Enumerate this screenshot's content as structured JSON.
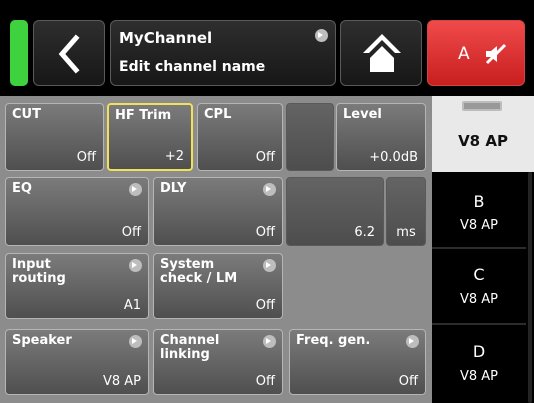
{
  "header": {
    "channel_name": "MyChannel",
    "edit_hint": "Edit channel name",
    "mute_label": "A"
  },
  "icons": {
    "status": "status-led-icon",
    "back": "chevron-left-icon",
    "home": "home-icon",
    "mute": "speaker-muted-icon",
    "submenu": "submenu-arrow-icon"
  },
  "colors": {
    "status_led": "#3fd23f",
    "mute_button": "#e0312f",
    "selected_outline": "#f0e15a"
  },
  "tiles": {
    "cut": {
      "label": "CUT",
      "value": "Off"
    },
    "hf_trim": {
      "label": "HF Trim",
      "value": "+2"
    },
    "cpl": {
      "label": "CPL",
      "value": "Off"
    },
    "level": {
      "label": "Level",
      "value": "+0.0dB"
    },
    "eq": {
      "label": "EQ",
      "value": "Off"
    },
    "dly": {
      "label": "DLY",
      "value": "Off"
    },
    "delay_value": "6.2",
    "delay_unit": "ms",
    "input_routing": {
      "label": "Input\nrouting",
      "value": "A1"
    },
    "system_check": {
      "label": "System\ncheck / LM",
      "value": "Off"
    },
    "speaker": {
      "label": "Speaker",
      "value": "V8 AP"
    },
    "channel_linking": {
      "label": "Channel\nlinking",
      "value": "Off"
    },
    "freq_gen": {
      "label": "Freq. gen.",
      "value": "Off"
    }
  },
  "devices": [
    {
      "letter": "",
      "type": "V8 AP",
      "active": true
    },
    {
      "letter": "B",
      "type": "V8 AP"
    },
    {
      "letter": "C",
      "type": "V8 AP"
    },
    {
      "letter": "D",
      "type": "V8 AP"
    }
  ]
}
